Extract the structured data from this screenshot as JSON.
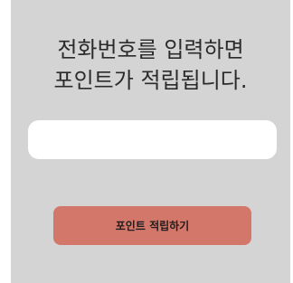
{
  "prompt": {
    "line1": "전화번호를 입력하면",
    "line2": "포인트가 적립됩니다."
  },
  "phone_input": {
    "value": "",
    "placeholder": ""
  },
  "submit_button": {
    "label": "포인트 적립하기"
  },
  "colors": {
    "panel_background": "#d4d4d4",
    "button_background": "#d4776b"
  }
}
